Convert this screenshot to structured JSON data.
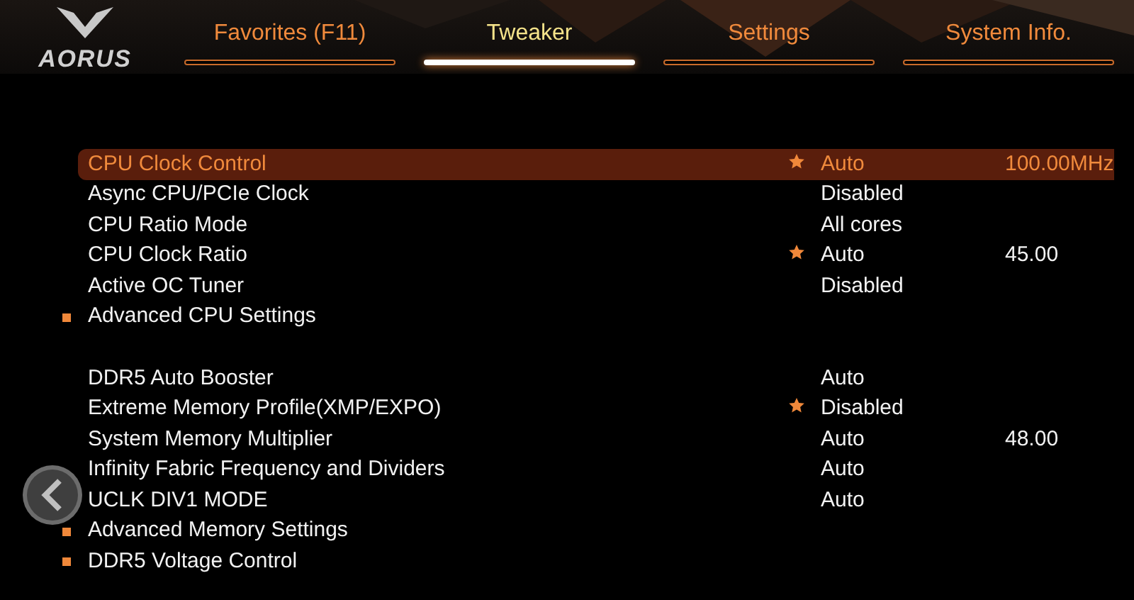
{
  "logo": {
    "text": "AORUS"
  },
  "tabs": [
    {
      "label": "Favorites (F11)",
      "selected": false
    },
    {
      "label": "Tweaker",
      "selected": true
    },
    {
      "label": "Settings",
      "selected": false
    },
    {
      "label": "System Info.",
      "selected": false
    }
  ],
  "groups": [
    {
      "items": [
        {
          "kind": "setting",
          "label": "CPU Clock Control",
          "selected": true,
          "starred": true,
          "value": "Auto",
          "reading": "100.00MHz"
        },
        {
          "kind": "setting",
          "label": "Async CPU/PCIe Clock",
          "selected": false,
          "starred": false,
          "value": "Disabled"
        },
        {
          "kind": "setting",
          "label": "CPU Ratio Mode",
          "selected": false,
          "starred": false,
          "value": "All cores"
        },
        {
          "kind": "setting",
          "label": "CPU Clock Ratio",
          "selected": false,
          "starred": true,
          "value": "Auto",
          "reading": "45.00"
        },
        {
          "kind": "setting",
          "label": "Active OC Tuner",
          "selected": false,
          "starred": false,
          "value": "Disabled"
        },
        {
          "kind": "submenu",
          "label": "Advanced CPU Settings",
          "selected": false
        }
      ]
    },
    {
      "items": [
        {
          "kind": "setting",
          "label": "DDR5 Auto Booster",
          "selected": false,
          "starred": false,
          "value": "Auto"
        },
        {
          "kind": "setting",
          "label": "Extreme Memory Profile(XMP/EXPO)",
          "selected": false,
          "starred": true,
          "value": "Disabled"
        },
        {
          "kind": "setting",
          "label": "System Memory Multiplier",
          "selected": false,
          "starred": false,
          "value": "Auto",
          "reading": "48.00"
        },
        {
          "kind": "setting",
          "label": "Infinity Fabric Frequency and Dividers",
          "selected": false,
          "starred": false,
          "value": "Auto"
        },
        {
          "kind": "setting",
          "label": "UCLK DIV1 MODE",
          "selected": false,
          "starred": false,
          "value": "Auto"
        },
        {
          "kind": "submenu",
          "label": "Advanced Memory Settings",
          "selected": false
        },
        {
          "kind": "submenu",
          "label": "DDR5 Voltage Control",
          "selected": false
        }
      ]
    }
  ]
}
